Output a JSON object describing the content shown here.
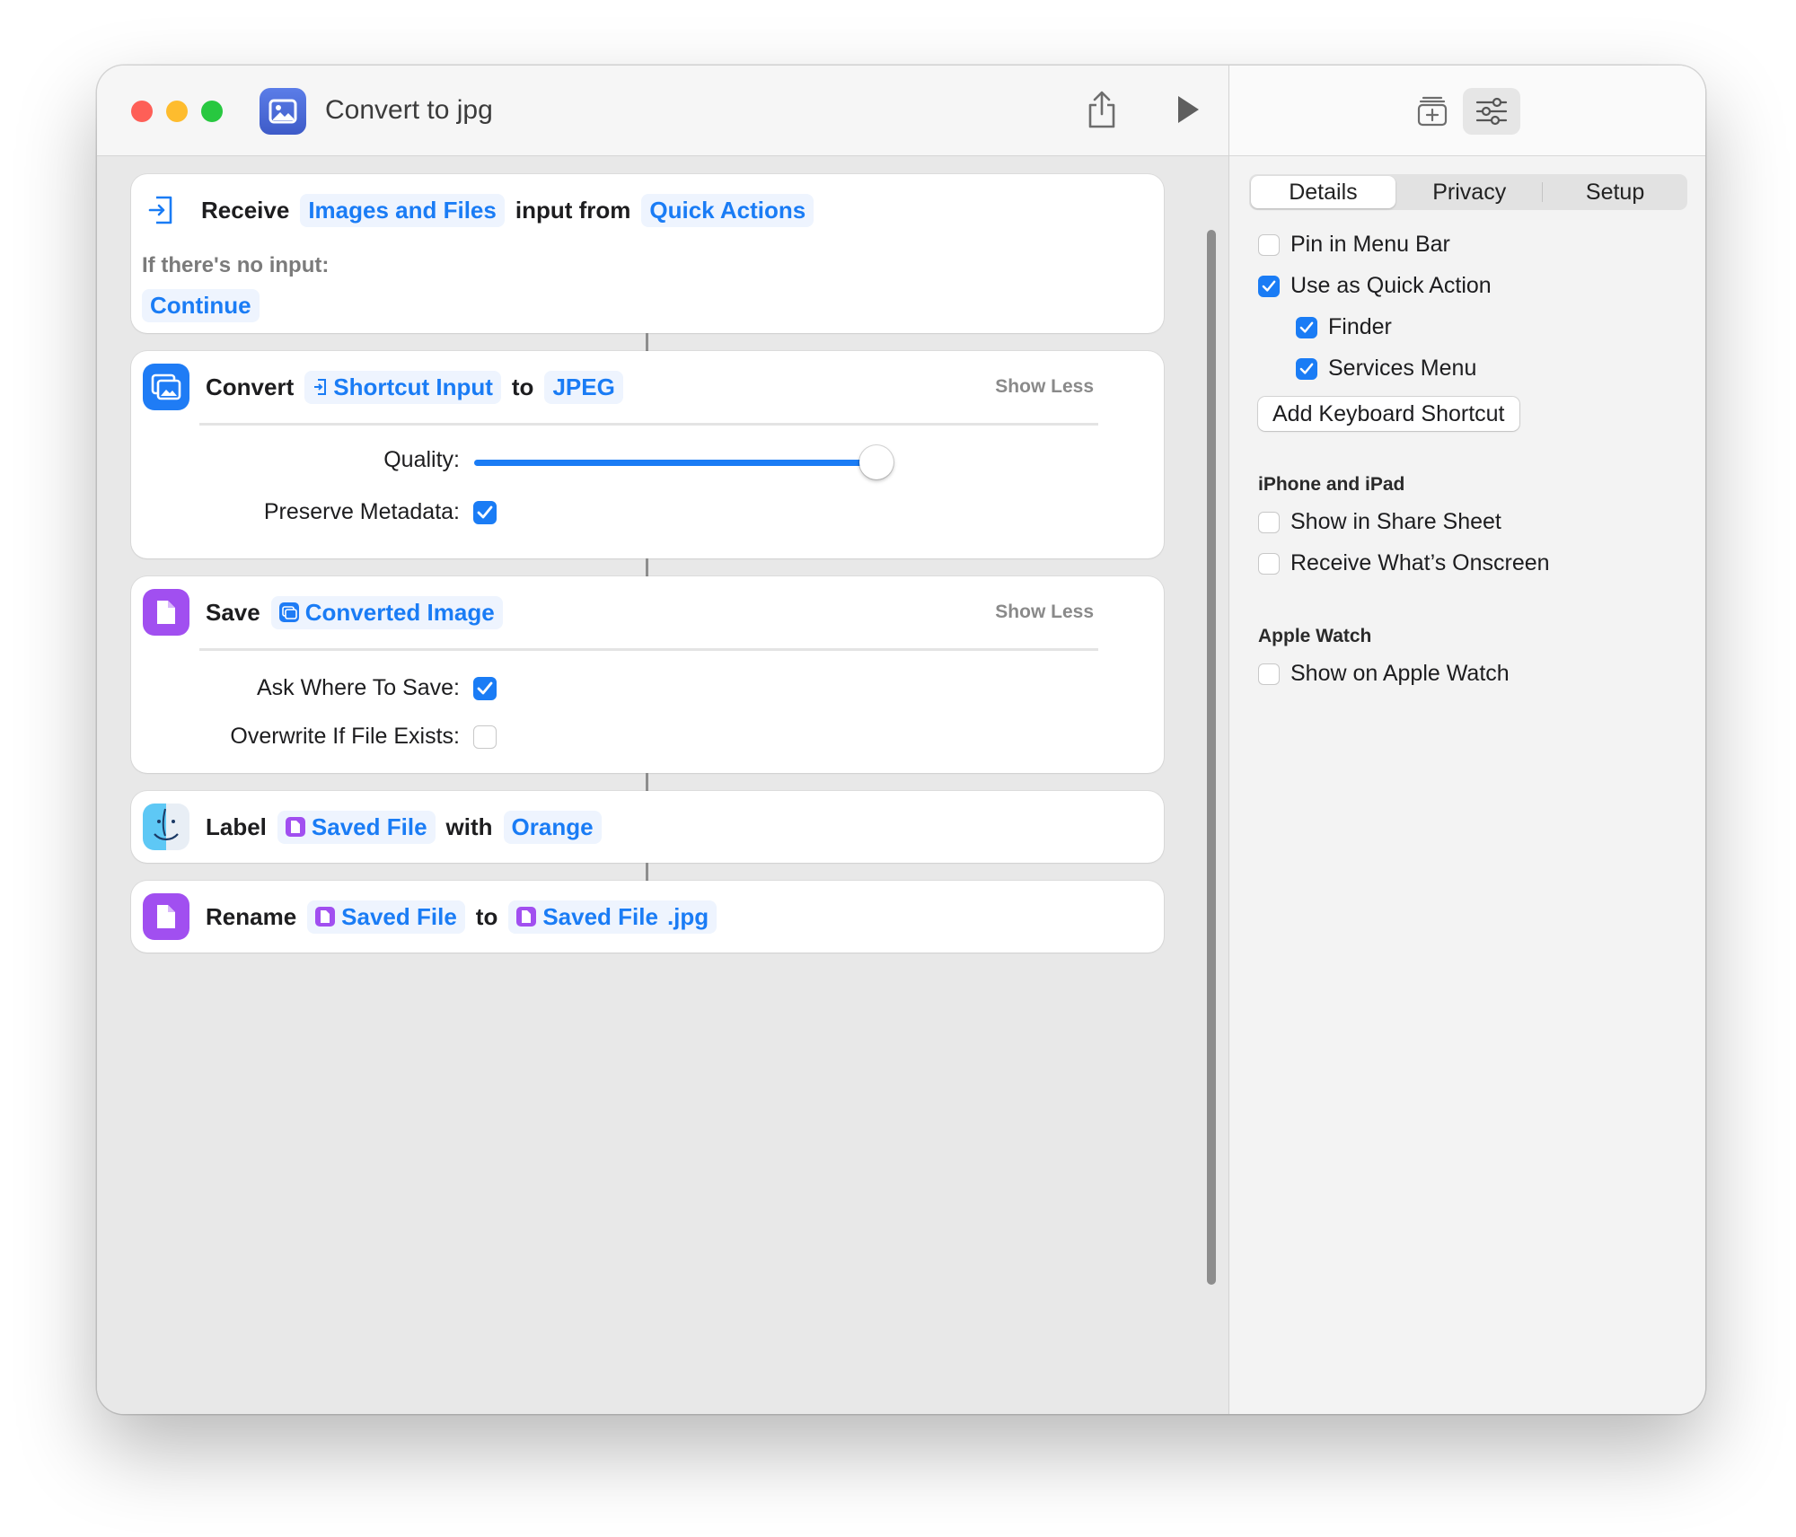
{
  "window": {
    "title": "Convert to jpg"
  },
  "editor": {
    "receive": {
      "keyword": "Receive",
      "input_types": "Images and Files",
      "middle": "input from",
      "source": "Quick Actions",
      "no_input_label": "If there's no input:",
      "no_input_action": "Continue"
    },
    "convert": {
      "keyword": "Convert",
      "input": "Shortcut Input",
      "middle": "to",
      "format": "JPEG",
      "show_less": "Show Less",
      "quality_label": "Quality:",
      "quality_value": 0.93,
      "preserve_label": "Preserve Metadata:",
      "preserve_checked": true
    },
    "save": {
      "keyword": "Save",
      "input": "Converted Image",
      "show_less": "Show Less",
      "ask_label": "Ask Where To Save:",
      "ask_checked": true,
      "overwrite_label": "Overwrite If File Exists:",
      "overwrite_checked": false
    },
    "label": {
      "keyword": "Label",
      "input": "Saved File",
      "middle": "with",
      "color": "Orange"
    },
    "rename": {
      "keyword": "Rename",
      "input": "Saved File",
      "middle": "to",
      "target": "Saved File",
      "suffix": ".jpg"
    }
  },
  "sidebar": {
    "tabs": [
      "Details",
      "Privacy",
      "Setup"
    ],
    "active_tab": "Details",
    "options": {
      "pin_menu_bar": "Pin in Menu Bar",
      "use_quick_action": "Use as Quick Action",
      "finder": "Finder",
      "services_menu": "Services Menu"
    },
    "add_shortcut": "Add Keyboard Shortcut",
    "iphone_heading": "iPhone and iPad",
    "share_sheet": "Show in Share Sheet",
    "onscreen": "Receive What’s Onscreen",
    "watch_heading": "Apple Watch",
    "show_watch": "Show on Apple Watch"
  },
  "colors": {
    "accent": "#1a7cf5",
    "purple": "#a14ff0",
    "close": "#fe5f57",
    "minimize": "#febc2e",
    "zoom": "#28c840"
  }
}
